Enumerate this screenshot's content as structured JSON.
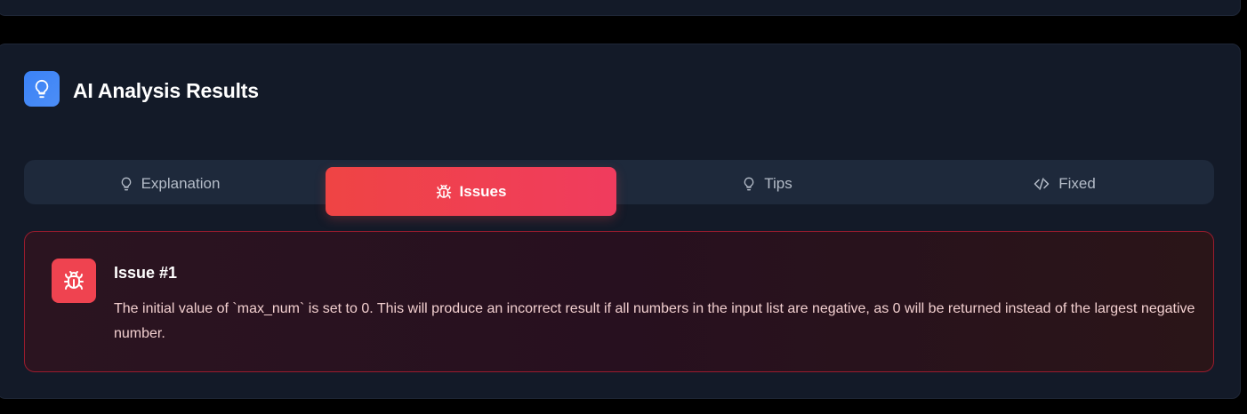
{
  "header": {
    "title": "AI Analysis Results",
    "icon": "lightbulb-icon"
  },
  "tabs": [
    {
      "label": "Explanation",
      "icon": "lightbulb-icon",
      "active": false
    },
    {
      "label": "Issues",
      "icon": "bug-icon",
      "active": true
    },
    {
      "label": "Tips",
      "icon": "lightbulb-icon",
      "active": false
    },
    {
      "label": "Fixed",
      "icon": "code-icon",
      "active": false
    }
  ],
  "issues": [
    {
      "title": "Issue #1",
      "icon": "bug-icon",
      "description": "The initial value of `max_num` is set to 0. This will produce an incorrect result if all numbers in the input list are negative, as 0 will be returned instead of the largest negative number."
    }
  ],
  "colors": {
    "accent_blue": "#3b82f6",
    "accent_red": "#ef4444",
    "background": "#131a28"
  }
}
